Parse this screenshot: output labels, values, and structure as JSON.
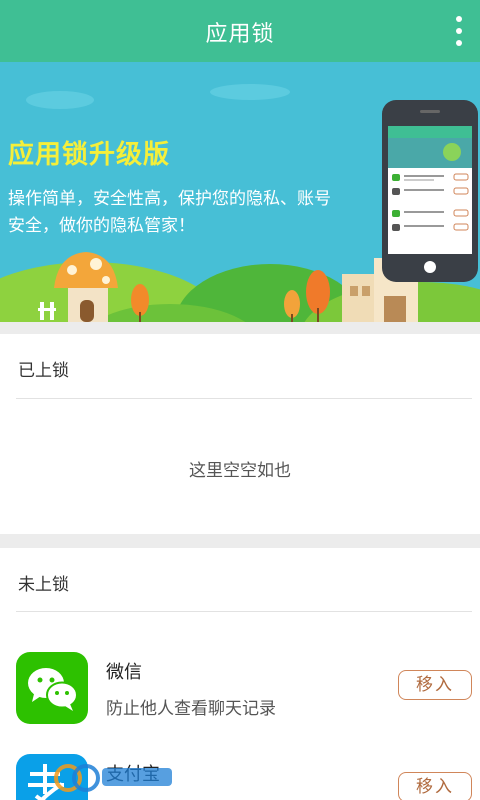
{
  "header": {
    "title": "应用锁"
  },
  "banner": {
    "headline": "应用锁升级版",
    "description": "操作简单，安全性高，保护您的隐私、账号安全，做你的隐私管家！"
  },
  "locked_section": {
    "title": "已上锁",
    "empty_text": "这里空空如也"
  },
  "unlocked_section": {
    "title": "未上锁",
    "apps": [
      {
        "name": "微信",
        "description": "防止他人查看聊天记录",
        "button": "移入",
        "icon": "wechat-icon"
      },
      {
        "name": "支付宝",
        "description": "",
        "button": "移入",
        "icon": "alipay-icon"
      }
    ]
  },
  "colors": {
    "accent": "#3fbf94",
    "banner": "#47bfd6",
    "headline": "#f5ef3a",
    "button_border": "#d0865a"
  }
}
